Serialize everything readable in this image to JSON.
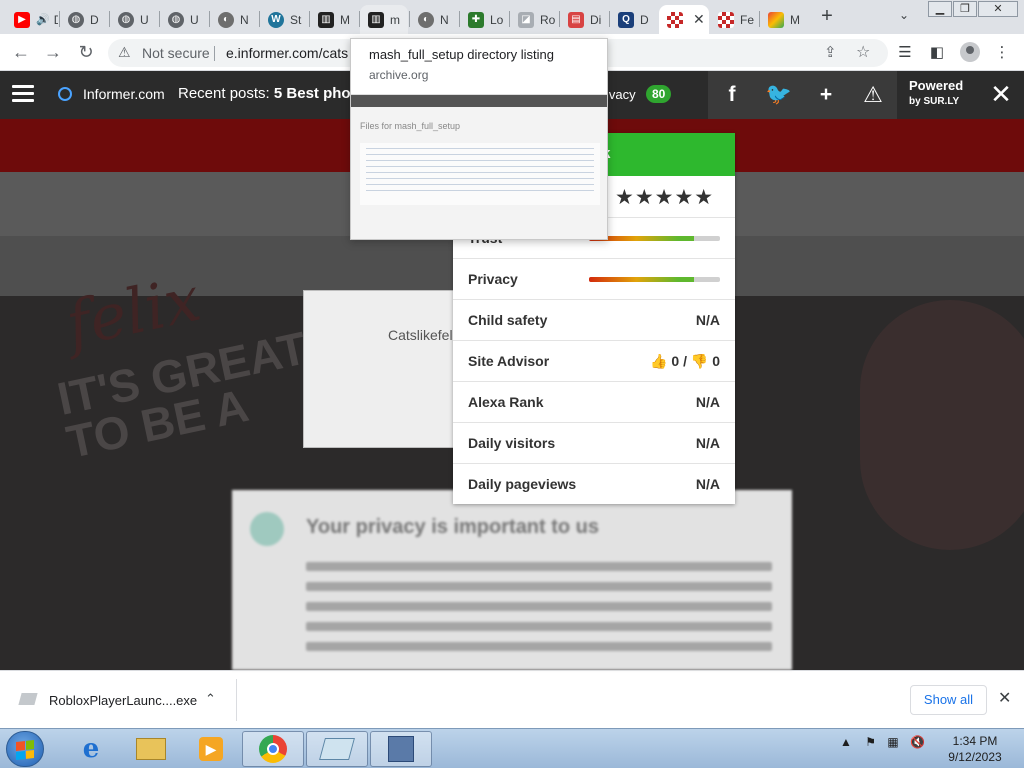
{
  "browser": {
    "tabs": [
      {
        "label": "D",
        "favicon": "youtube-icon",
        "audio": true
      },
      {
        "label": "D",
        "favicon": "globe-icon"
      },
      {
        "label": "U",
        "favicon": "globe-icon"
      },
      {
        "label": "U",
        "favicon": "globe-icon"
      },
      {
        "label": "N",
        "favicon": "privacy-browser-icon"
      },
      {
        "label": "St",
        "favicon": "wordpress-icon"
      },
      {
        "label": "M",
        "favicon": "archive-icon"
      },
      {
        "label": "m",
        "favicon": "archive-icon"
      },
      {
        "label": "N",
        "favicon": "privacy-browser-icon"
      },
      {
        "label": "Lo",
        "favicon": "minecraft-icon"
      },
      {
        "label": "Ro",
        "favicon": "roblox-icon"
      },
      {
        "label": "Di",
        "favicon": "red-page-icon"
      },
      {
        "label": "D",
        "favicon": "blue-q-icon"
      },
      {
        "label": "",
        "favicon": "checker-icon",
        "active": true
      },
      {
        "label": "Fe",
        "favicon": "checker-icon"
      },
      {
        "label": "M",
        "favicon": "chrome-store-icon"
      }
    ],
    "hover_card": {
      "title": "mash_full_setup directory listing",
      "domain": "archive.org",
      "thumb_title": "Files for mash_full_setup"
    },
    "address": {
      "security": "Not secure",
      "url": "e.informer.com/cats"
    }
  },
  "informer": {
    "site": "Informer.com",
    "recent_label": "Recent posts:",
    "recent_title": "5 Best pho",
    "privacy_label": "ivacy",
    "privacy_score": "80",
    "social": [
      "f",
      "t",
      "+",
      "!"
    ],
    "powered_line1": "Powered",
    "powered_line2": "by SUR.LY",
    "close": "✕"
  },
  "panel": {
    "header": "uk",
    "stars": "★★★★★",
    "rows": [
      {
        "label": "Trust",
        "meter": 0.8
      },
      {
        "label": "Privacy",
        "meter": 0.8
      },
      {
        "label": "Child safety",
        "value": "N/A"
      },
      {
        "label": "Site Advisor",
        "up": "0",
        "down": "0"
      },
      {
        "label": "Alexa Rank",
        "value": "N/A"
      },
      {
        "label": "Daily visitors",
        "value": "N/A"
      },
      {
        "label": "Daily pageviews",
        "value": "N/A"
      }
    ]
  },
  "page": {
    "cats_text": "Catslikefel",
    "privacy_title": "Your privacy is important to us",
    "hero_brand": "felix",
    "hero_tag": "IT'S GREAT TO BE A"
  },
  "download": {
    "file": "RobloxPlayerLaunc....exe",
    "show_all": "Show all"
  },
  "taskbar": {
    "time": "1:34 PM",
    "date": "9/12/2023"
  }
}
